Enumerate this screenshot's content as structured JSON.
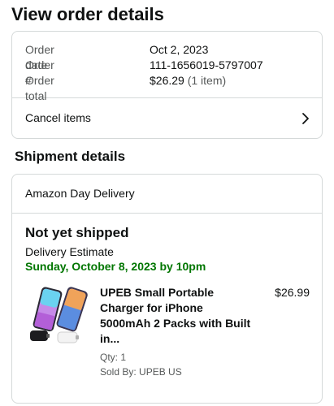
{
  "page": {
    "title": "View order details"
  },
  "order_summary": {
    "date_label": "Order date",
    "date_value": "Oct 2, 2023",
    "number_label": "Order #",
    "number_value": "111-1656019-5797007",
    "total_label": "Order total",
    "total_value": "$26.29",
    "total_items": "(1 item)",
    "cancel_label": "Cancel items",
    "cancel_icon": "chevron-right-icon"
  },
  "shipment": {
    "section_title": "Shipment details",
    "delivery_type": "Amazon Day Delivery",
    "status": "Not yet shipped",
    "estimate_label": "Delivery Estimate",
    "estimate_date": "Sunday, October 8, 2023 by 10pm",
    "estimate_color": "#007600",
    "item": {
      "title": "UPEB Small Portable Charger for iPhone 5000mAh 2 Packs with Built in...",
      "price": "$26.99",
      "qty": "Qty: 1",
      "seller": "Sold By: UPEB US",
      "image_icon": "portable-charger-product-image"
    }
  },
  "colors": {
    "text": "#0f1111",
    "muted": "#565959",
    "border": "#d5d9d9"
  }
}
